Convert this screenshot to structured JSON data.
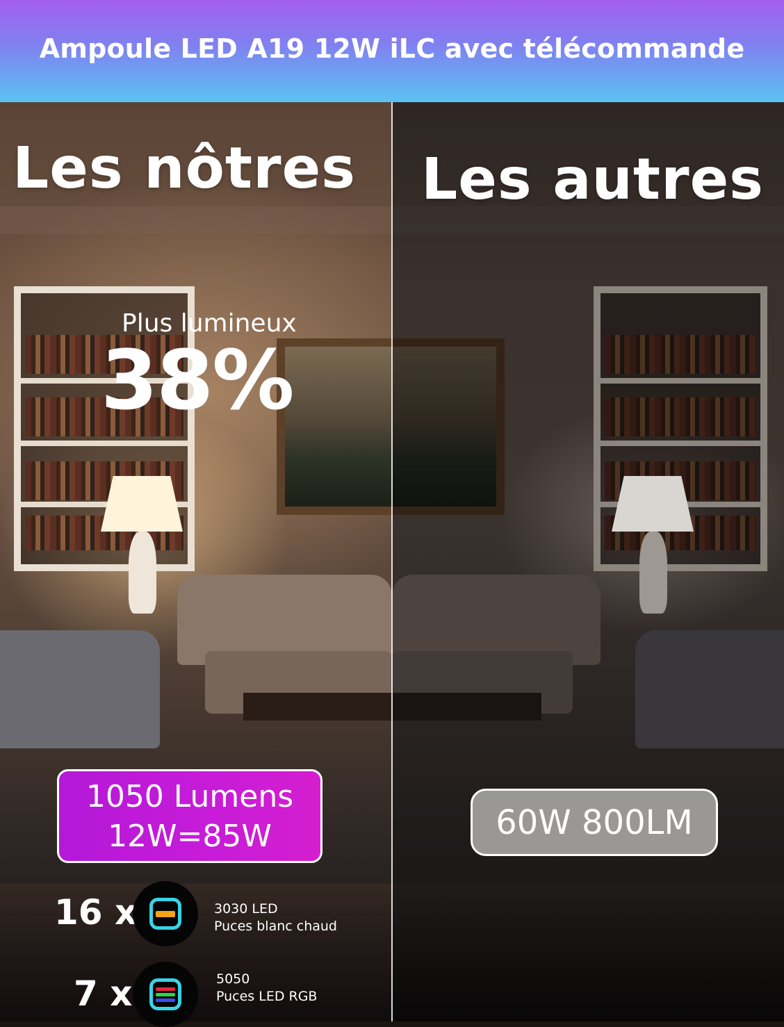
{
  "header": {
    "title": "Ampoule LED A19 12W iLC avec télécommande"
  },
  "comparison": {
    "ours_heading": "Les nôtres",
    "others_heading": "Les autres"
  },
  "brightness": {
    "label": "Plus lumineux",
    "value": "38%"
  },
  "ours_spec": {
    "line1": "1050 Lumens",
    "line2": "12W=85W"
  },
  "others_spec": {
    "label": "60W 800LM"
  },
  "chips": [
    {
      "count": "16 x",
      "line1": "3030 LED",
      "line2": "Puces blanc chaud",
      "icon": "warm-led-chip-icon",
      "colors": [
        "#f5a318"
      ]
    },
    {
      "count": "7 x",
      "line1": "5050",
      "line2": "Puces LED RGB",
      "icon": "rgb-led-chip-icon",
      "colors": [
        "#e8253a",
        "#2fd34a",
        "#3d4df0"
      ]
    }
  ],
  "colors": {
    "header_gradient": [
      "#a45ff0",
      "#7f82f0",
      "#5bc2f2"
    ],
    "ours_badge": "#c81cd8",
    "others_badge": "#9a9896",
    "chip_outline": "#39d3e6"
  }
}
